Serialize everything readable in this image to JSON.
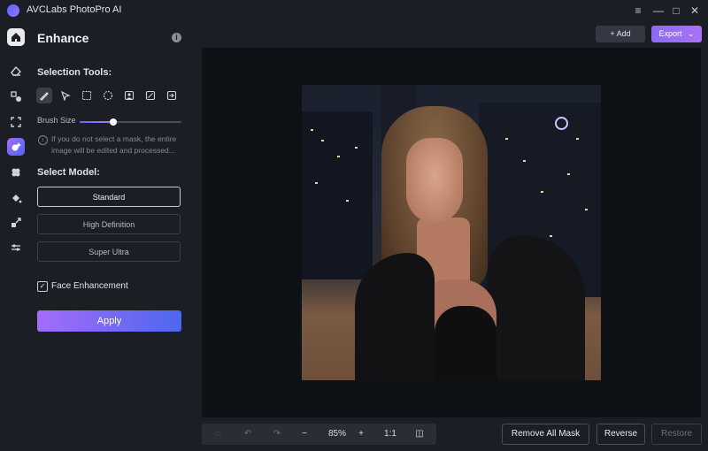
{
  "app": {
    "title": "AVCLabs PhotoPro AI"
  },
  "window": {
    "menu_icon": "≡",
    "minimize_icon": "—",
    "maximize_icon": "□",
    "close_icon": "✕"
  },
  "panel": {
    "title": "Enhance",
    "selection_tools_label": "Selection Tools:",
    "brush_size_label": "Brush Size",
    "brush_size_value": 0.33,
    "hint": "If you do not select a mask, the entire image will be edited and processed...",
    "select_model_label": "Select Model:",
    "models": [
      "Standard",
      "High Definition",
      "Super Ultra"
    ],
    "selected_model": "Standard",
    "face_enhancement_label": "Face Enhancement",
    "face_enhancement_checked": true,
    "apply_label": "Apply"
  },
  "toolbar": {
    "add_label": "+ Add",
    "export_label": "Export"
  },
  "bottom": {
    "zoom": "85%",
    "minus": "−",
    "plus": "+",
    "ratio": "1:1",
    "remove_all_mask": "Remove All Mask",
    "reverse": "Reverse",
    "restore": "Restore"
  },
  "colors": {
    "accent_start": "#a46cf9",
    "accent_end": "#4d67ef",
    "background": "#1b1e24",
    "canvas": "#0e1116"
  }
}
